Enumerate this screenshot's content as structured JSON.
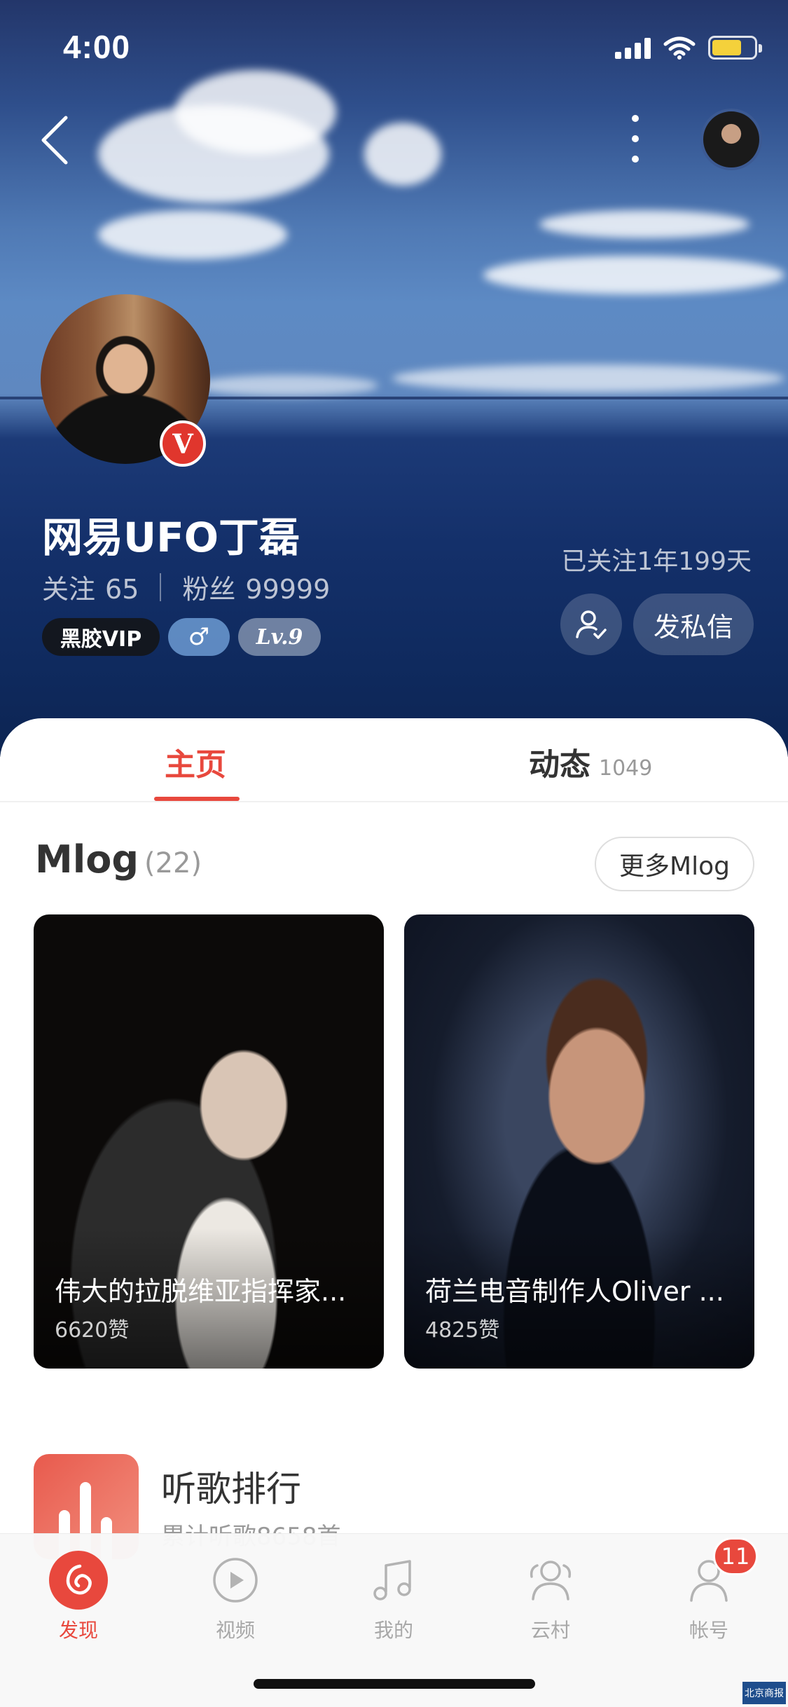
{
  "status_bar": {
    "time": "4:00"
  },
  "profile": {
    "name": "网易UFO丁磊",
    "verified_badge": "V",
    "following_label": "关注",
    "following_count": "65",
    "fans_label": "粉丝",
    "fans_count": "99999",
    "vip_badge": "黑胶VIP",
    "gender_badge": "♂",
    "level_badge": "Lv.9",
    "followed_since": "已关注1年199天",
    "message_button": "发私信"
  },
  "tabs": {
    "home": "主页",
    "activity": "动态",
    "activity_count": "1049"
  },
  "mlog": {
    "title": "Mlog",
    "count": "(22)",
    "more_button": "更多Mlog",
    "cards": [
      {
        "title": "伟大的拉脱维亚指挥家...",
        "likes": "6620赞"
      },
      {
        "title": "荷兰电音制作人Oliver ...",
        "likes": "4825赞"
      }
    ]
  },
  "ranking": {
    "title": "听歌排行",
    "subtitle": "累计听歌8658首"
  },
  "bottom_nav": {
    "items": [
      {
        "label": "发现",
        "icon": "discover-icon"
      },
      {
        "label": "视频",
        "icon": "video-icon"
      },
      {
        "label": "我的",
        "icon": "music-note-icon"
      },
      {
        "label": "云村",
        "icon": "community-icon"
      },
      {
        "label": "帐号",
        "icon": "account-icon"
      }
    ],
    "account_badge": "11"
  },
  "colors": {
    "accent": "#e8483d",
    "sea_blue": "#14306a"
  },
  "watermark": "北京商报"
}
